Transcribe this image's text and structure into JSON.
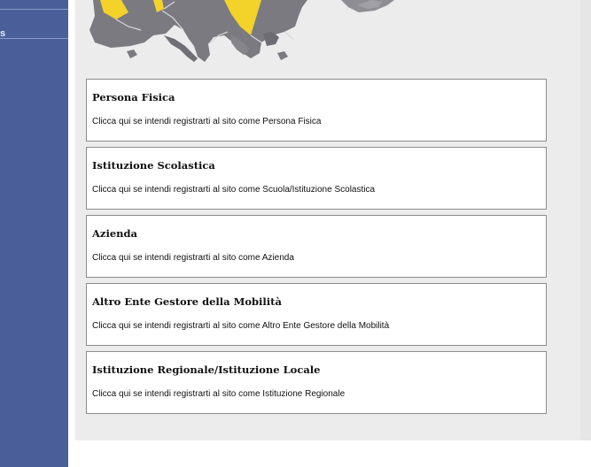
{
  "sidebar": {
    "nav_label": "s",
    "background_color": "#4a5f99"
  },
  "banner": {
    "image": "europe-map-fragment"
  },
  "options": [
    {
      "title": "Persona Fisica",
      "description": "Clicca qui se intendi registrarti al sito come Persona Fisica"
    },
    {
      "title": "Istituzione Scolastica",
      "description": "Clicca qui se intendi registrarti al sito come Scuola/Istituzione Scolastica"
    },
    {
      "title": "Azienda",
      "description": "Clicca qui se intendi registrarti al sito come Azienda"
    },
    {
      "title": "Altro Ente Gestore della Mobilità",
      "description": "Clicca qui se intendi registrarti al sito come Altro Ente Gestore della Mobilità"
    },
    {
      "title": "Istituzione Regionale/Istituzione Locale",
      "description": "Clicca qui se intendi registrarti al sito come Istituzione Regionale"
    }
  ]
}
